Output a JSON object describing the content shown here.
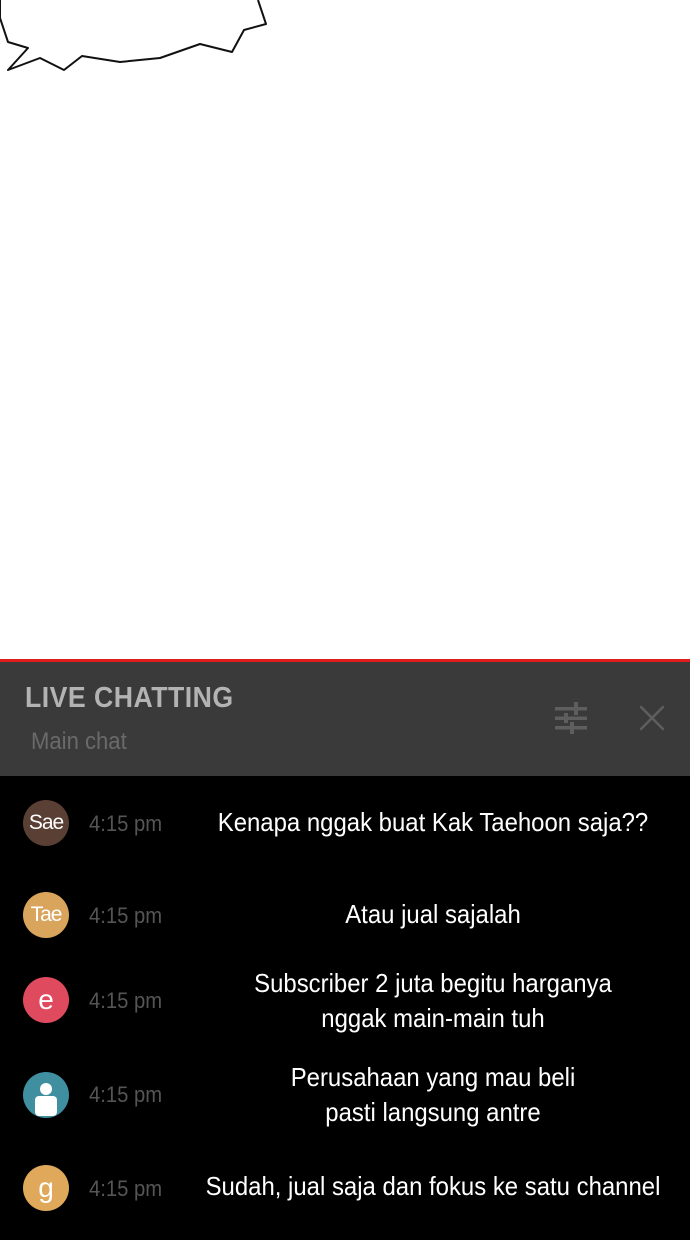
{
  "colors": {
    "accent_line": "#e11d1d",
    "header_bg": "#3a3a3a",
    "chat_bg": "#000000",
    "title": "#b3b3b3",
    "subtitle": "#6a6a6a",
    "time": "#555555",
    "message": "#ffffff"
  },
  "chat": {
    "title": "LIVE CHATTING",
    "subtitle": "Main chat",
    "filter_icon": "filter-sliders-icon",
    "close_icon": "close-icon"
  },
  "messages": [
    {
      "avatar_label": "Sae",
      "avatar_color": "#5a3f34",
      "time": "4:15 pm",
      "text": "Kenapa nggak buat Kak Taehoon saja??"
    },
    {
      "avatar_label": "Tae",
      "avatar_color": "#d9a45c",
      "time": "4:15 pm",
      "text": "Atau jual sajalah"
    },
    {
      "avatar_label": "e",
      "avatar_color": "#e04a5f",
      "time": "4:15 pm",
      "text_lines": [
        "Subscriber 2 juta begitu harganya",
        "nggak main-main tuh"
      ]
    },
    {
      "avatar_icon": "user-silhouette-icon",
      "avatar_color": "#3f8fa0",
      "time": "4:15 pm",
      "text_lines": [
        "Perusahaan yang mau beli",
        "pasti langsung antre"
      ]
    },
    {
      "avatar_label": "g",
      "avatar_color": "#e0a85a",
      "time": "4:15 pm",
      "text": "Sudah, jual saja dan fokus ke satu channel"
    }
  ]
}
